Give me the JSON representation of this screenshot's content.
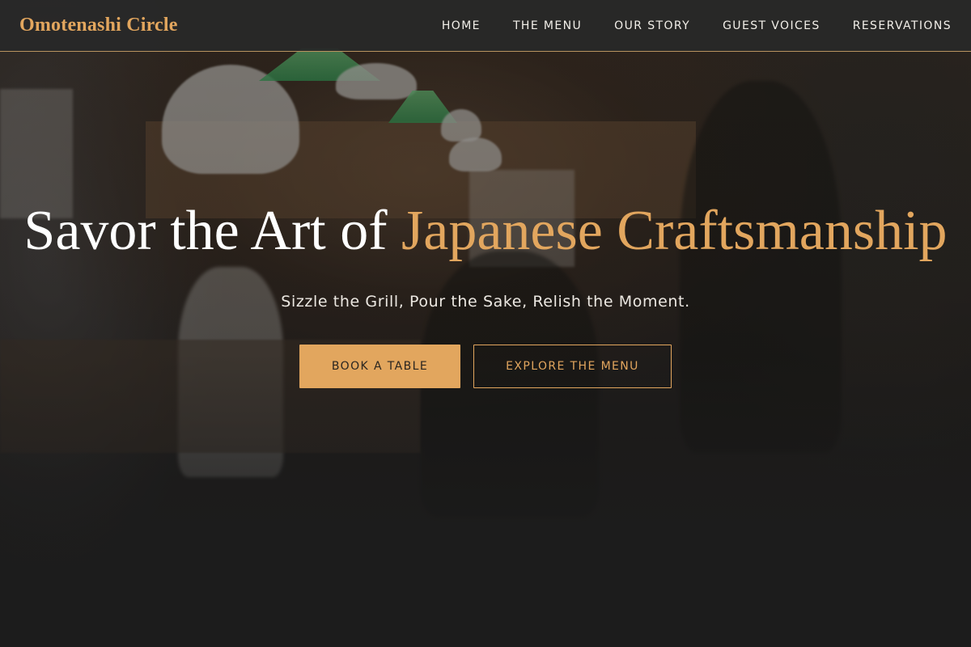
{
  "nav": {
    "brand": "Omotenashi Circle",
    "links": [
      {
        "label": "HOME"
      },
      {
        "label": "THE MENU"
      },
      {
        "label": "OUR STORY"
      },
      {
        "label": "GUEST VOICES"
      },
      {
        "label": "RESERVATIONS"
      }
    ]
  },
  "hero": {
    "title_prefix": "Savor the Art of ",
    "title_accent": "Japanese Craftsmanship",
    "subtitle": "Sizzle the Grill, Pour the Sake, Relish the Moment.",
    "primary_button": "BOOK A TABLE",
    "secondary_button": "EXPLORE THE MENU"
  },
  "colors": {
    "accent": "#e2a65e",
    "nav_background": "#282828",
    "page_background": "#1c1c1c",
    "text_light": "#ffffff"
  }
}
